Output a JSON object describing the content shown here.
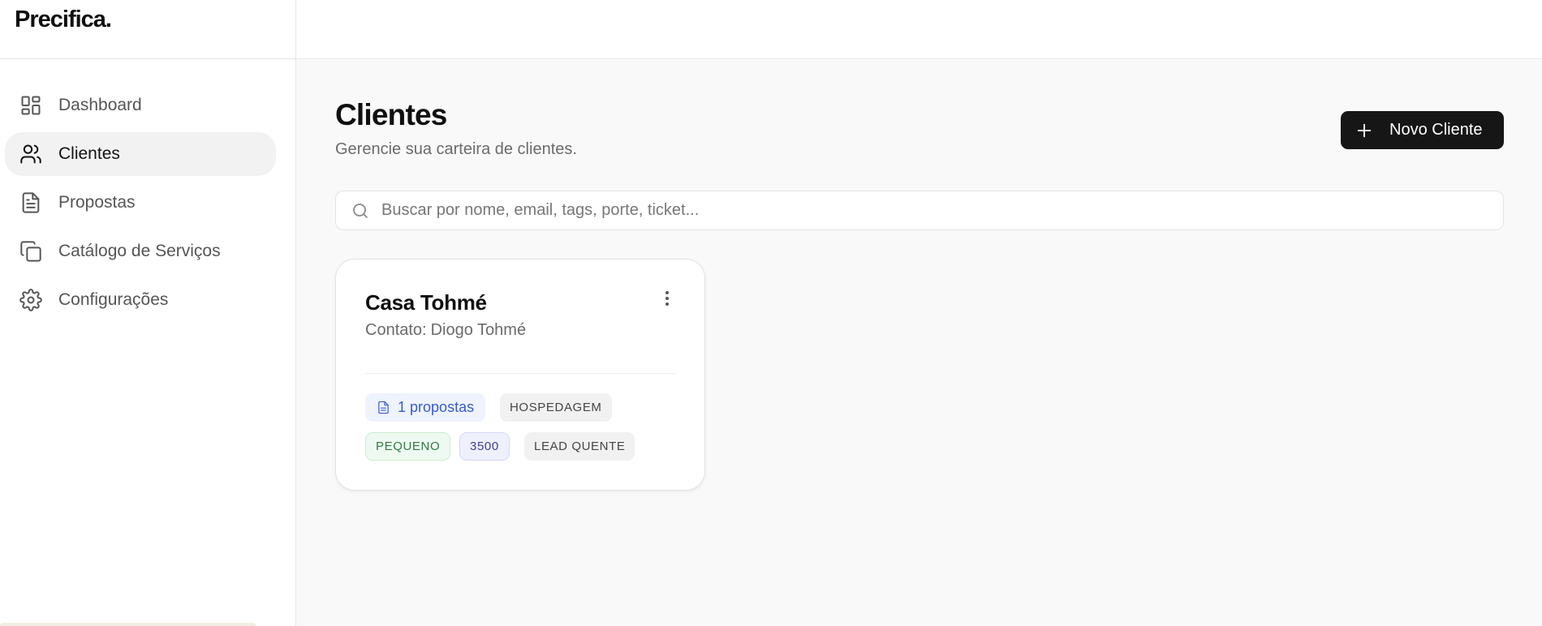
{
  "brand": {
    "name": "Precifica."
  },
  "sidebar": {
    "items": [
      {
        "label": "Dashboard",
        "icon": "dashboard-icon",
        "active": false
      },
      {
        "label": "Clientes",
        "icon": "users-icon",
        "active": true
      },
      {
        "label": "Propostas",
        "icon": "document-icon",
        "active": false
      },
      {
        "label": "Catálogo de Serviços",
        "icon": "copy-icon",
        "active": false
      },
      {
        "label": "Configurações",
        "icon": "gear-icon",
        "active": false
      }
    ]
  },
  "header": {
    "title": "Clientes",
    "subtitle": "Gerencie sua carteira de clientes.",
    "new_button_label": "Novo Cliente"
  },
  "search": {
    "placeholder": "Buscar por nome, email, tags, porte, ticket...",
    "value": ""
  },
  "clients": [
    {
      "name": "Casa Tohmé",
      "contact_label": "Contato:",
      "contact_name": "Diogo Tohmé",
      "proposals_count": "1",
      "proposals_label": "propostas",
      "tags": {
        "segment": "HOSPEDAGEM",
        "size": "PEQUENO",
        "ticket": "3500",
        "status": "LEAD QUENTE"
      }
    }
  ],
  "colors": {
    "accent_dark": "#161616",
    "proposal_chip": "#3a5cc9",
    "size_chip": "#2f7a45",
    "ticket_chip": "#3d3c9a"
  }
}
